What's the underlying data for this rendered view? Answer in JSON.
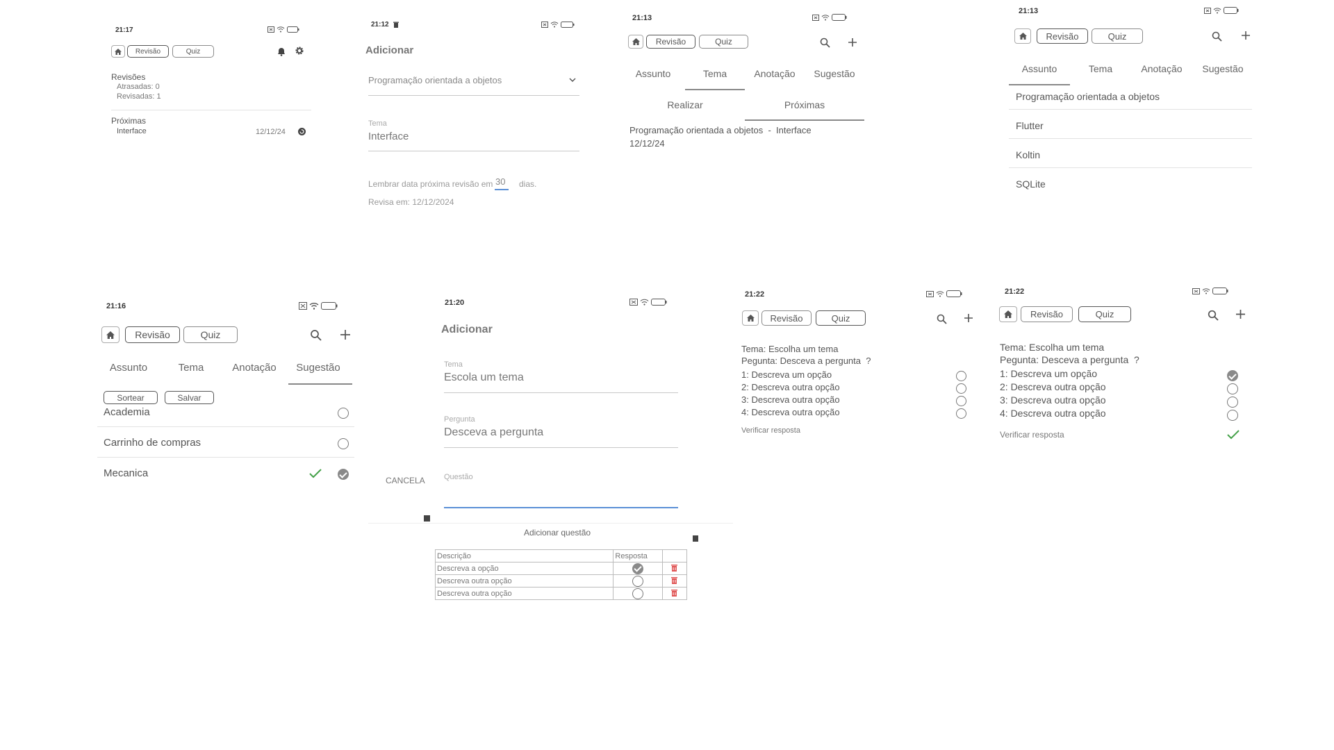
{
  "screens": {
    "s1": {
      "time": "21:17",
      "battery": "90",
      "nav": {
        "revisao": "Revisão",
        "quiz": "Quiz"
      },
      "revisoes": {
        "title": "Revisões",
        "atrasadas": "Atrasadas: 0",
        "revisadas": "Revisadas: 1"
      },
      "proximas": {
        "title": "Próximas",
        "item": "Interface",
        "date": "12/12/24"
      }
    },
    "s2": {
      "time": "21:12",
      "battery": "90",
      "title": "Adicionar",
      "dropdown_value": "Programação orientada a objetos",
      "tema_label": "Tema",
      "tema_value": "Interface",
      "remind_prefix": "Lembrar data próxima revisão em",
      "remind_days": "30",
      "remind_suffix": "dias.",
      "revisa_em": "Revisa em: 12/12/2024"
    },
    "s3": {
      "time": "21:13",
      "battery": "90",
      "nav": {
        "revisao": "Revisão",
        "quiz": "Quiz"
      },
      "tabs": [
        "Assunto",
        "Tema",
        "Anotação",
        "Sugestão"
      ],
      "subtabs": [
        "Realizar",
        "Próximas"
      ],
      "entry_line1": "Programação orientada a objetos  -  Interface",
      "entry_line2": "12/12/24"
    },
    "s4": {
      "time": "21:13",
      "battery": "90",
      "nav": {
        "revisao": "Revisão",
        "quiz": "Quiz"
      },
      "tabs": [
        "Assunto",
        "Tema",
        "Anotação",
        "Sugestão"
      ],
      "items": [
        "Programação orientada a objetos",
        "Flutter",
        "Koltin",
        "SQLite"
      ]
    },
    "s5": {
      "time": "21:16",
      "battery": "90",
      "nav": {
        "revisao": "Revisão",
        "quiz": "Quiz"
      },
      "tabs": [
        "Assunto",
        "Tema",
        "Anotação",
        "Sugestão"
      ],
      "sortear": "Sortear",
      "salvar": "Salvar",
      "items": [
        "Academia",
        "Carrinho de compras",
        "Mecanica"
      ]
    },
    "s6": {
      "time": "21:20",
      "battery": "90",
      "title": "Adicionar",
      "tema_label": "Tema",
      "tema_value": "Escola um tema",
      "pergunta_label": "Pergunta",
      "pergunta_value": "Desceva a pergunta",
      "cancel": "CANCELA",
      "questao_label": "Questão",
      "add_questao": "Adicionar questão",
      "table_headers": [
        "Descrição",
        "Resposta"
      ],
      "rows": [
        "Descreva a opção",
        "Descreva outra opção",
        "Descreva outra opção"
      ]
    },
    "s7": {
      "time": "21:22",
      "battery": "89",
      "nav": {
        "revisao": "Revisão",
        "quiz": "Quiz"
      },
      "tema": "Tema: Escolha um tema",
      "pergunta": "Pegunta: Desceva a pergunta  ?",
      "options": [
        "1: Descreva um opção",
        "2: Descreva outra opção",
        "3: Descreva outra opção",
        "4: Descreva outra opção"
      ],
      "verify": "Verificar resposta"
    },
    "s8": {
      "time": "21:22",
      "battery": "89",
      "nav": {
        "revisao": "Revisão",
        "quiz": "Quiz"
      },
      "tema": "Tema: Escolha um tema",
      "pergunta": "Pegunta: Desceva a pergunta  ?",
      "options": [
        "1: Descreva um opção",
        "2: Descreva outra opção",
        "3: Descreva outra opção",
        "4: Descreva outra opção"
      ],
      "verify": "Verificar resposta"
    }
  },
  "colors": {
    "accent_blue": "#5b8fd6",
    "check_green": "#43a047",
    "delete_red": "#e05555"
  },
  "icons": [
    "home-icon",
    "bell-icon",
    "gear-icon",
    "search-icon",
    "plus-icon",
    "chevron-down-icon",
    "trash-icon",
    "check-icon",
    "wifi-icon",
    "battery-icon"
  ]
}
